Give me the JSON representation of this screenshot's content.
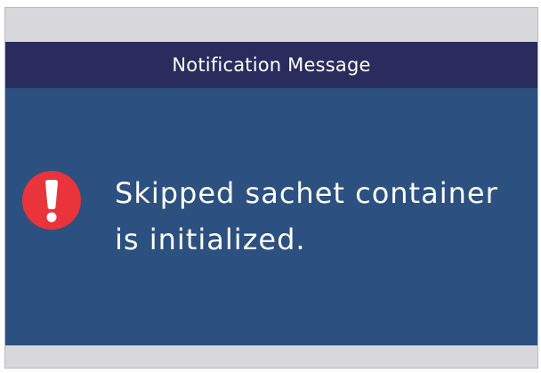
{
  "dialog": {
    "title": "Notification Message",
    "icon": "alert-exclamation-icon",
    "message_lines": [
      "Skipped sachet container",
      "is initialized."
    ]
  },
  "colors": {
    "title_bar": "#2a2c5e",
    "panel": "#2c5080",
    "alert_icon": "#e8343a",
    "frame": "#d8d8da"
  }
}
